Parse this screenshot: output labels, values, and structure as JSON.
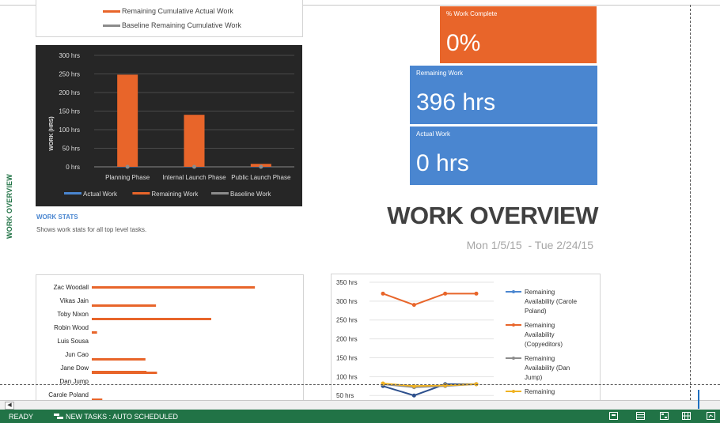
{
  "sidebar": {
    "view_label": "WORK OVERVIEW"
  },
  "burndown_legend": {
    "items": [
      {
        "label": "Remaining Cumulative Actual Work",
        "color": "#e8652a"
      },
      {
        "label": "Baseline Remaining Cumulative Work",
        "color": "#8c8c8c"
      }
    ]
  },
  "work_chart": {
    "legend": [
      {
        "label": "Actual Work",
        "color": "#4a86d0"
      },
      {
        "label": "Remaining Work",
        "color": "#e8652a"
      },
      {
        "label": "Baseline Work",
        "color": "#8c8c8c"
      }
    ]
  },
  "chart_data": [
    {
      "type": "bar",
      "ylabel": "WORK (HRS)",
      "categories": [
        "Planning Phase",
        "Internal Launch Phase",
        "Public Launch Phase"
      ],
      "ytick_labels": [
        "0 hrs",
        "50 hrs",
        "100 hrs",
        "150 hrs",
        "200 hrs",
        "250 hrs",
        "300 hrs"
      ],
      "ylim": [
        0,
        300
      ],
      "series": [
        {
          "name": "Actual Work",
          "values": [
            0,
            0,
            0
          ]
        },
        {
          "name": "Remaining Work",
          "values": [
            248,
            140,
            8
          ]
        },
        {
          "name": "Baseline Work",
          "values": [
            0,
            0,
            0
          ]
        }
      ],
      "grid": true,
      "legend_position": "bottom"
    },
    {
      "type": "bar",
      "orientation": "horizontal",
      "categories": [
        "Zac Woodall",
        "Vikas Jain",
        "Toby Nixon",
        "Robin Wood",
        "Luis Sousa",
        "Jun Cao",
        "Jane Dow",
        "Dan Jump",
        "Carole Poland"
      ],
      "series": [
        {
          "values": [
            0,
            0,
            0,
            0,
            0,
            0,
            0,
            0,
            0
          ]
        },
        {
          "values": [
            310,
            122,
            227,
            10,
            0,
            102,
            124,
            0,
            20
          ]
        },
        {
          "values": [
            0,
            0,
            0,
            0,
            0,
            0,
            0,
            0,
            0
          ]
        },
        {
          "values": [
            0,
            0,
            0,
            0,
            0,
            0,
            104,
            0,
            0
          ]
        }
      ],
      "grid": false
    },
    {
      "type": "line",
      "x": [
        1,
        2,
        3,
        4
      ],
      "ytick_labels": [
        "50 hrs",
        "100 hrs",
        "150 hrs",
        "200 hrs",
        "250 hrs",
        "300 hrs",
        "350 hrs"
      ],
      "ylim": [
        40,
        350
      ],
      "series": [
        {
          "name": "Remaining Availability (Carole Poland)",
          "values": [
            75,
            50,
            80,
            80
          ]
        },
        {
          "name": "Remaining Availability (Copyeditors)",
          "values": [
            320,
            290,
            320,
            320
          ]
        },
        {
          "name": "Remaining Availability (Dan Jump)",
          "values": [
            80,
            72,
            75,
            80
          ]
        },
        {
          "name": "Remaining",
          "values": [
            82,
            75,
            77,
            80
          ]
        }
      ],
      "grid": true,
      "legend_position": "right"
    }
  ],
  "kpis": {
    "percent_complete": {
      "label": "% Work Complete",
      "value": "0%"
    },
    "remaining_work": {
      "label": "Remaining Work",
      "value": "396 hrs"
    },
    "actual_work": {
      "label": "Actual Work",
      "value": "0 hrs"
    }
  },
  "report": {
    "title": "WORK OVERVIEW",
    "start_date": "Mon 1/5/15",
    "end_date": "Tue 2/24/15",
    "date_separator": "-"
  },
  "work_stats": {
    "heading": "WORK STATS",
    "description": "Shows work stats for all top level tasks."
  },
  "statusbar": {
    "ready": "READY",
    "new_tasks": "NEW TASKS : AUTO SCHEDULED"
  },
  "colors": {
    "accent_orange": "#e8652a",
    "accent_blue": "#4a86d0",
    "baseline_gray": "#8c8c8c",
    "status_green": "#217346",
    "series_gold": "#f0b323",
    "series_navy": "#2c4f8c"
  }
}
